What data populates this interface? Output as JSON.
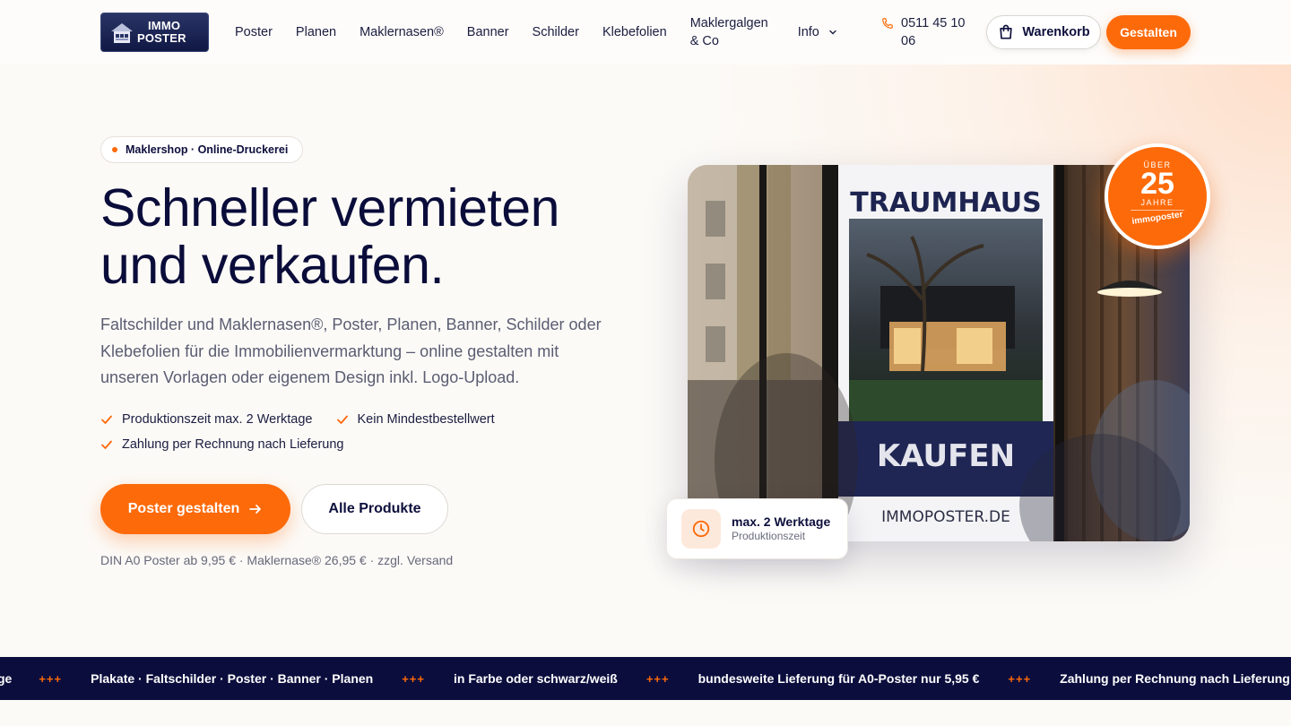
{
  "brand": {
    "line1": "IMMO",
    "line2": "POSTER"
  },
  "nav": {
    "items": [
      {
        "label": "Poster"
      },
      {
        "label": "Planen"
      },
      {
        "label": "Maklernasen®"
      },
      {
        "label": "Banner"
      },
      {
        "label": "Schilder"
      },
      {
        "label": "Klebefolien"
      },
      {
        "label": "Maklergalgen & Co"
      },
      {
        "label": "Info"
      }
    ],
    "phone": "0511 45 10 06",
    "cart_label": "Warenkorb",
    "cta_label": "Gestalten"
  },
  "hero": {
    "badge": "Maklershop · Online-Druckerei",
    "title_line1": "Schneller vermieten",
    "title_line2": "und verkaufen.",
    "lead": "Faltschilder und Maklernasen®, Poster, Planen, Banner, Schilder oder Klebefolien für die Immobilienvermarktung – online gestalten mit unseren Vorlagen oder eigenem Design inkl. Logo-Upload.",
    "features": [
      "Produktionszeit max. 2 Werktage",
      "Kein Mindestbestellwert",
      "Zahlung per Rechnung nach Lieferung"
    ],
    "primary_button": "Poster gestalten",
    "secondary_button": "Alle Produkte",
    "price_note": "DIN A0 Poster ab 9,95 € · Maklernase® 26,95 € · zzgl. Versand"
  },
  "image": {
    "sign_title": "TRAUMHAUS",
    "sign_action": "KAUFEN",
    "sign_url": "IMMOPOSTER.DE"
  },
  "seal": {
    "top": "ÜBER",
    "number": "25",
    "unit": "JAHRE",
    "brand": "immoposter"
  },
  "info_card": {
    "title": "max. 2 Werktage",
    "subtitle": "Produktionszeit"
  },
  "ticker": {
    "separator": "+++",
    "lead_fragment": "ge",
    "items": [
      "Plakate · Faltschilder · Poster · Banner · Planen",
      "in Farbe oder schwarz/weiß",
      "bundesweite Lieferung für A0-Poster nur 5,95 €",
      "Zahlung per Rechnung nach Lieferung"
    ]
  },
  "colors": {
    "accent": "#fd6a0a",
    "navy": "#0b0d3d",
    "background": "#fcfaf7"
  }
}
